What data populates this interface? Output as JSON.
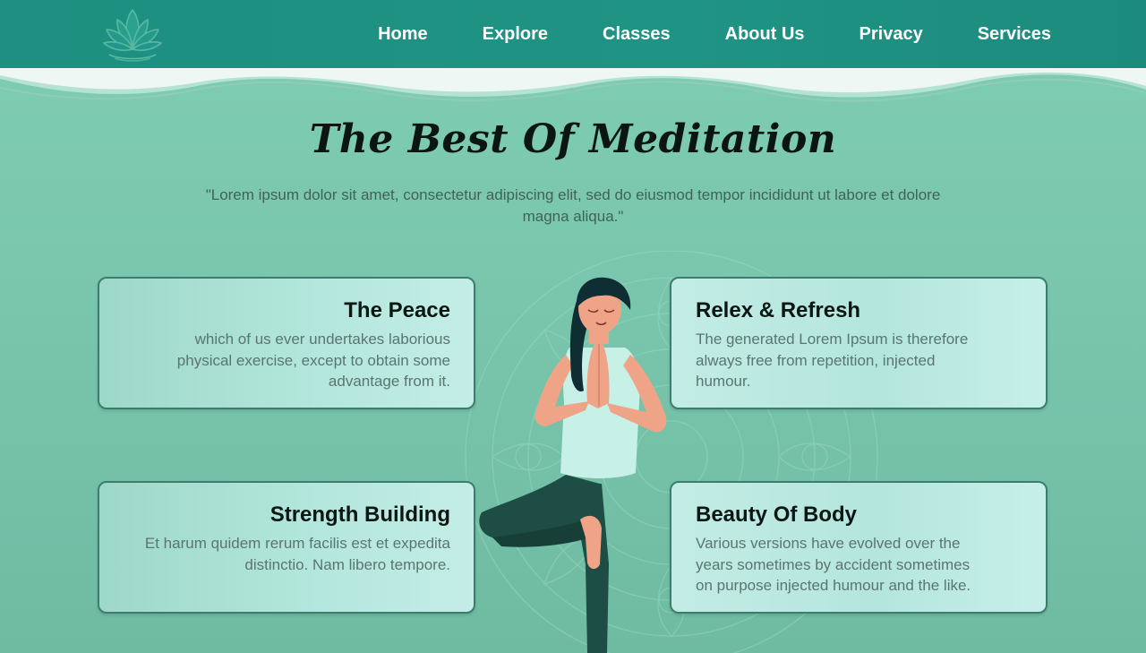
{
  "nav": {
    "items": [
      {
        "label": "Home"
      },
      {
        "label": "Explore"
      },
      {
        "label": "Classes"
      },
      {
        "label": "About Us"
      },
      {
        "label": "Privacy"
      },
      {
        "label": "Services"
      }
    ]
  },
  "hero": {
    "title": "The Best Of Meditation",
    "quote": "\"Lorem ipsum dolor sit amet, consectetur adipiscing elit, sed do eiusmod tempor incididunt ut labore et dolore magna aliqua.\""
  },
  "cards": [
    {
      "title": "The Peace",
      "text": "which of us ever undertakes laborious physical exercise, except to obtain some advantage from it."
    },
    {
      "title": "Relex & Refresh",
      "text": "The generated Lorem Ipsum is therefore always free from repetition, injected humour."
    },
    {
      "title": "Strength Building",
      "text": "Et harum quidem rerum facilis est et expedita distinctio. Nam libero tempore."
    },
    {
      "title": "Beauty Of Body",
      "text": "Various versions have evolved over the years sometimes by accident sometimes on purpose injected humour and the like."
    }
  ],
  "icons": {
    "logo": "lotus-logo-icon",
    "illustration": "yoga-woman-tree-pose-illustration",
    "background": "mandala-pattern"
  },
  "colors": {
    "navbar": "#1e8f80",
    "background": "#7fcdb3",
    "card_border": "#3c7d70",
    "title_text": "#0b1512",
    "body_text": "#5b7570"
  }
}
